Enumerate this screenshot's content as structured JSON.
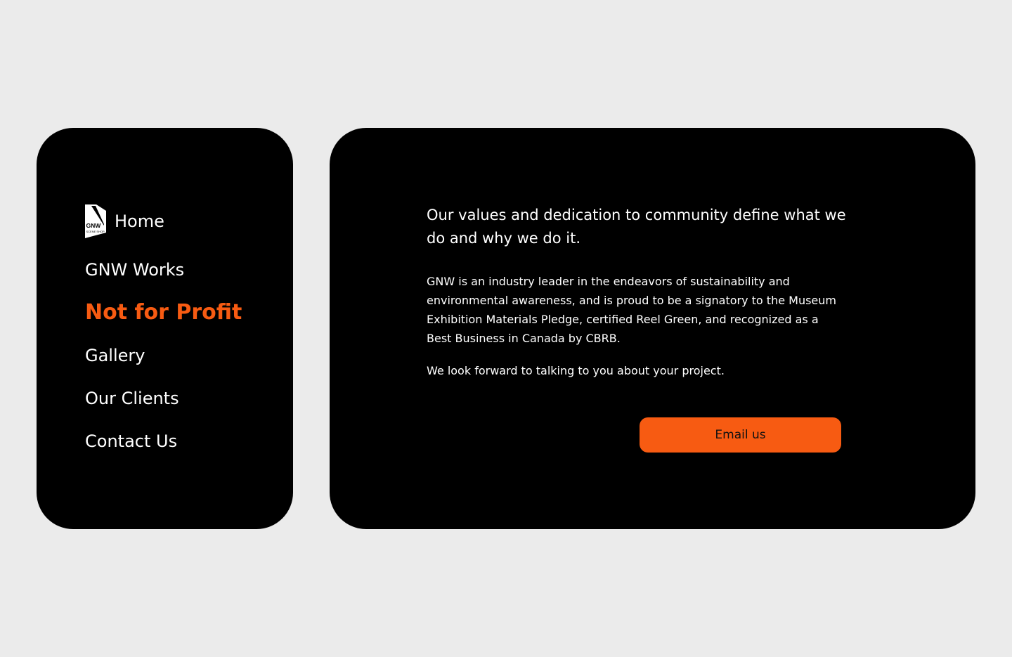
{
  "brand": {
    "logo_text_top": "GNW",
    "logo_text_bottom": "SCENE SHOP"
  },
  "nav": {
    "items": [
      {
        "label": "Home"
      },
      {
        "label": "GNW Works"
      },
      {
        "label": "Not for Profit"
      },
      {
        "label": "Gallery"
      },
      {
        "label": "Our Clients"
      },
      {
        "label": "Contact Us"
      }
    ],
    "active_item": "Not for Profit"
  },
  "content": {
    "headline": "Our values and dedication to community define what we do and why we do it.",
    "body": "GNW is an industry leader in the endeavors of sustainability and environmental awareness, and is proud to be a signatory to the Museum Exhibition Materials Pledge, certified Reel Green, and recognized as a Best Business in Canada by CBRB.",
    "closing": "We look forward to talking to you about your project.",
    "cta_label": "Email us"
  },
  "colors": {
    "page_background": "#ebebeb",
    "panel_background": "#000000",
    "accent": "#f75b12",
    "text": "#ffffff"
  },
  "icons": {
    "logo": "gnw-scene-shop-logo"
  }
}
